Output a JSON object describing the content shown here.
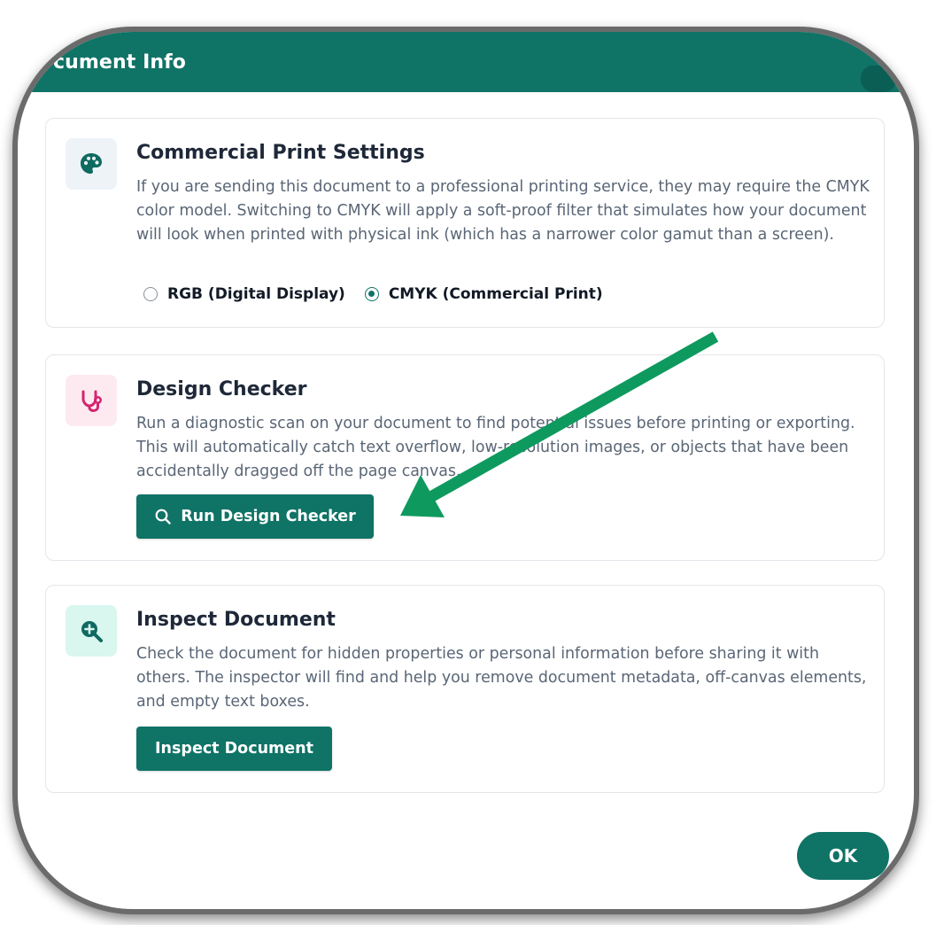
{
  "dialog": {
    "title": "cument Info"
  },
  "print_settings": {
    "icon": "palette-icon",
    "title": "Commercial Print Settings",
    "description": "If you are sending this document to a professional printing service, they may require the CMYK color model. Switching to CMYK will apply a soft-proof filter that simulates how your document will look when printed with physical ink (which has a narrower color gamut than a screen).",
    "options": [
      {
        "label": "RGB (Digital Display)",
        "selected": false
      },
      {
        "label": "CMYK (Commercial Print)",
        "selected": true
      }
    ]
  },
  "design_checker": {
    "icon": "stethoscope-icon",
    "title": "Design Checker",
    "description": "Run a diagnostic scan on your document to find potential issues before printing or exporting. This will automatically catch text overflow, low-resolution images, or objects that have been accidentally dragged off the page canvas.",
    "button_label": "Run Design Checker",
    "button_icon": "search-icon"
  },
  "inspect": {
    "icon": "zoom-in-icon",
    "title": "Inspect Document",
    "description": "Check the document for hidden properties or personal information before sharing it with others. The inspector will find and help you remove document metadata, off-canvas elements, and empty text boxes.",
    "button_label": "Inspect Document"
  },
  "footer": {
    "ok_label": "OK"
  },
  "colors": {
    "accent": "#0f7366",
    "annotation_arrow": "#0e9a5e",
    "palette_icon": "#0f6a60",
    "stethoscope_icon": "#d6246e",
    "zoom_icon": "#0f6a60"
  }
}
